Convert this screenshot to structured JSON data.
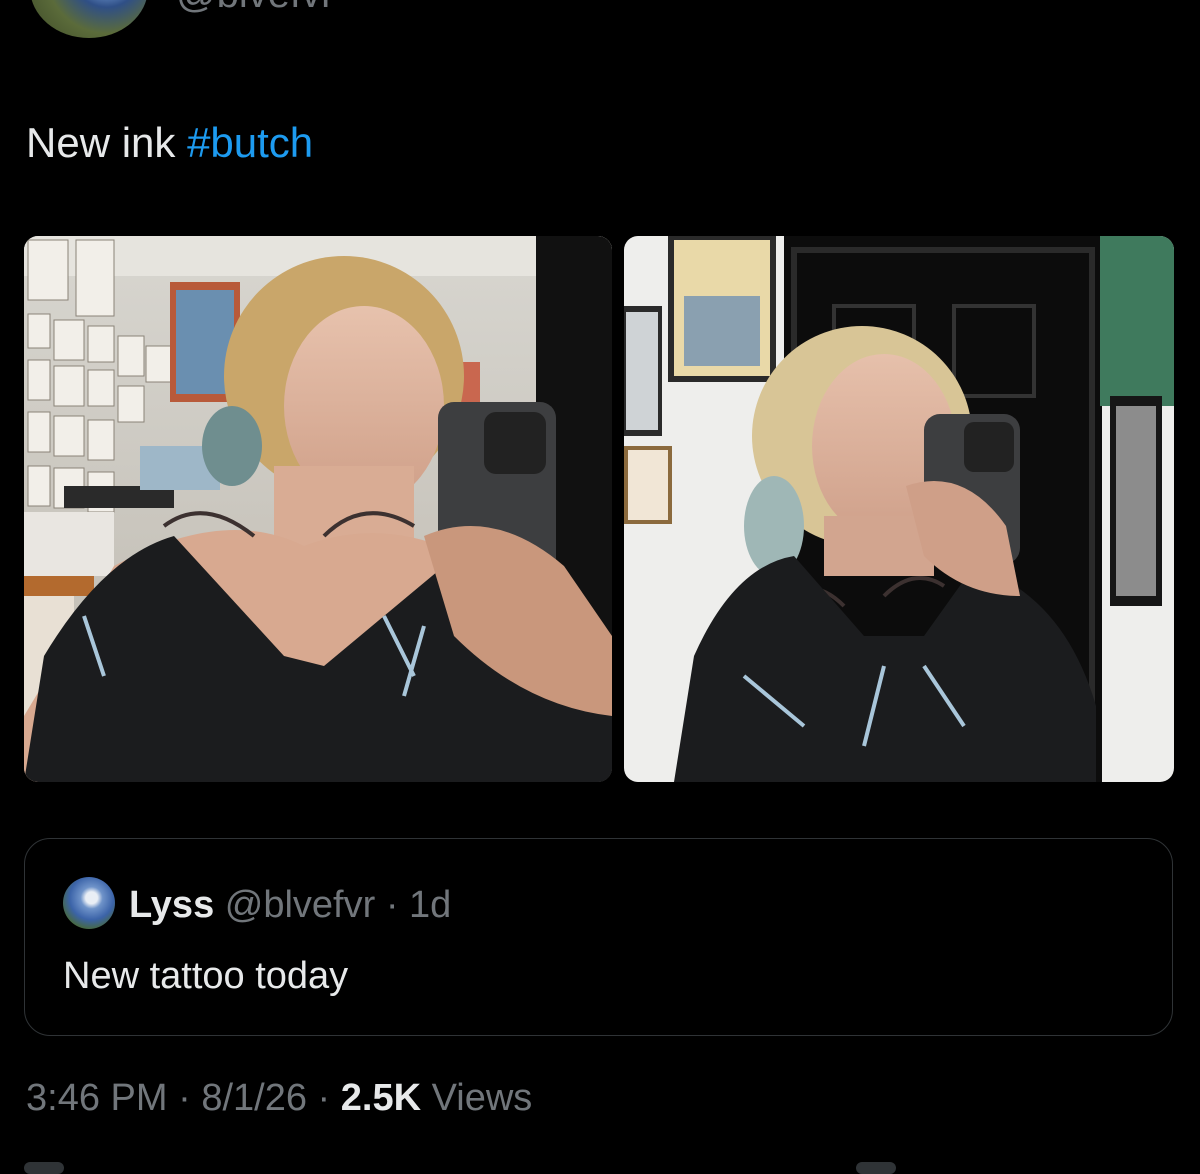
{
  "header": {
    "handle": "@blvefvr"
  },
  "tweet": {
    "text": "New ink ",
    "hashtag": "#butch"
  },
  "quote": {
    "name": "Lyss",
    "handle": "@blvefvr",
    "separator": " · ",
    "age": "1d",
    "text": "New tattoo today"
  },
  "footer": {
    "time": "3:46 PM",
    "sep1": " · ",
    "date": "8/1/26",
    "sep2": " · ",
    "views_count": "2.5K",
    "views_label": " Views"
  },
  "colors": {
    "accent": "#1d9bf0",
    "text": "#e7e9ea",
    "muted": "#71767b",
    "border": "#2f3336"
  }
}
